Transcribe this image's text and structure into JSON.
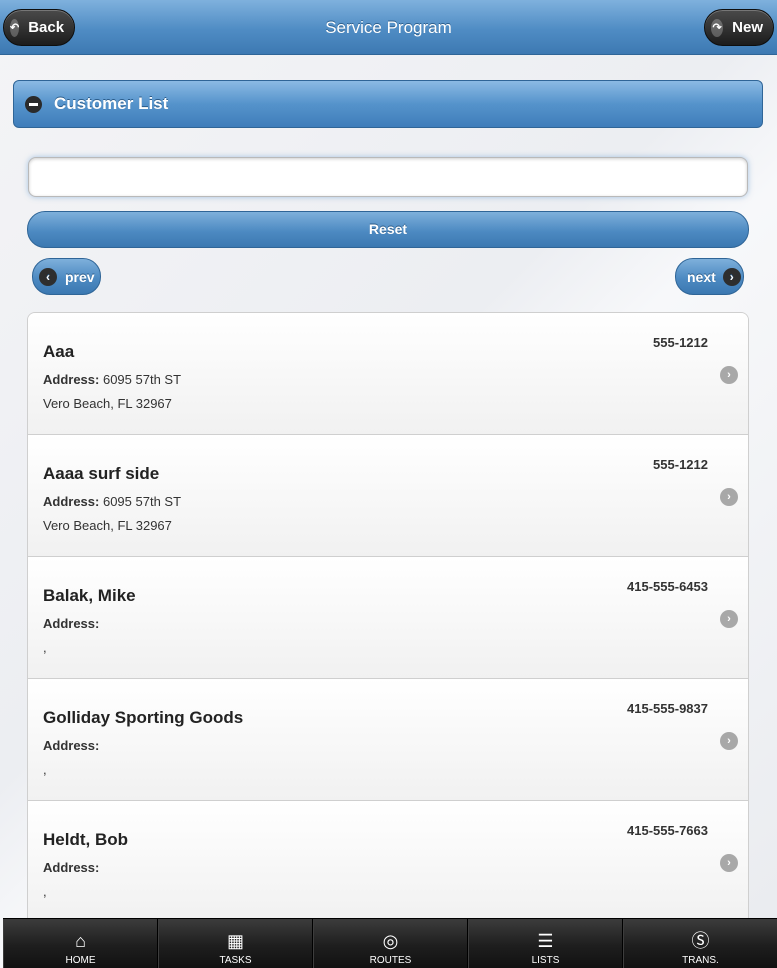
{
  "header": {
    "title": "Service Program",
    "back_label": "Back",
    "new_label": "New"
  },
  "collapsible": {
    "title": "Customer List"
  },
  "search": {
    "value": "",
    "placeholder": ""
  },
  "reset_label": "Reset",
  "pager": {
    "prev_label": "prev",
    "next_label": "next"
  },
  "customers": [
    {
      "name": "Aaa",
      "phone": "555-1212",
      "address_label": "Address:",
      "street": " 6095 57th ST",
      "city_line": "Vero Beach, FL 32967"
    },
    {
      "name": "Aaaa surf side",
      "phone": "555-1212",
      "address_label": "Address:",
      "street": " 6095 57th ST",
      "city_line": "Vero Beach, FL 32967"
    },
    {
      "name": "Balak, Mike",
      "phone": "415-555-6453",
      "address_label": "Address:",
      "street": "",
      "city_line": ","
    },
    {
      "name": "Golliday Sporting Goods",
      "phone": "415-555-9837",
      "address_label": "Address:",
      "street": "",
      "city_line": ","
    },
    {
      "name": "Heldt, Bob",
      "phone": "415-555-7663",
      "address_label": "Address:",
      "street": "",
      "city_line": ","
    }
  ],
  "footer": {
    "tabs": [
      {
        "label": "HOME",
        "icon": "home-icon"
      },
      {
        "label": "TASKS",
        "icon": "calendar-icon"
      },
      {
        "label": "ROUTES",
        "icon": "globe-icon"
      },
      {
        "label": "LISTS",
        "icon": "list-icon"
      },
      {
        "label": "TRANS.",
        "icon": "dollar-icon"
      }
    ]
  },
  "colors": {
    "header_blue": "#4f8cc4",
    "button_blue": "#4d8ac2",
    "footer_dark": "#1e1e1e"
  }
}
